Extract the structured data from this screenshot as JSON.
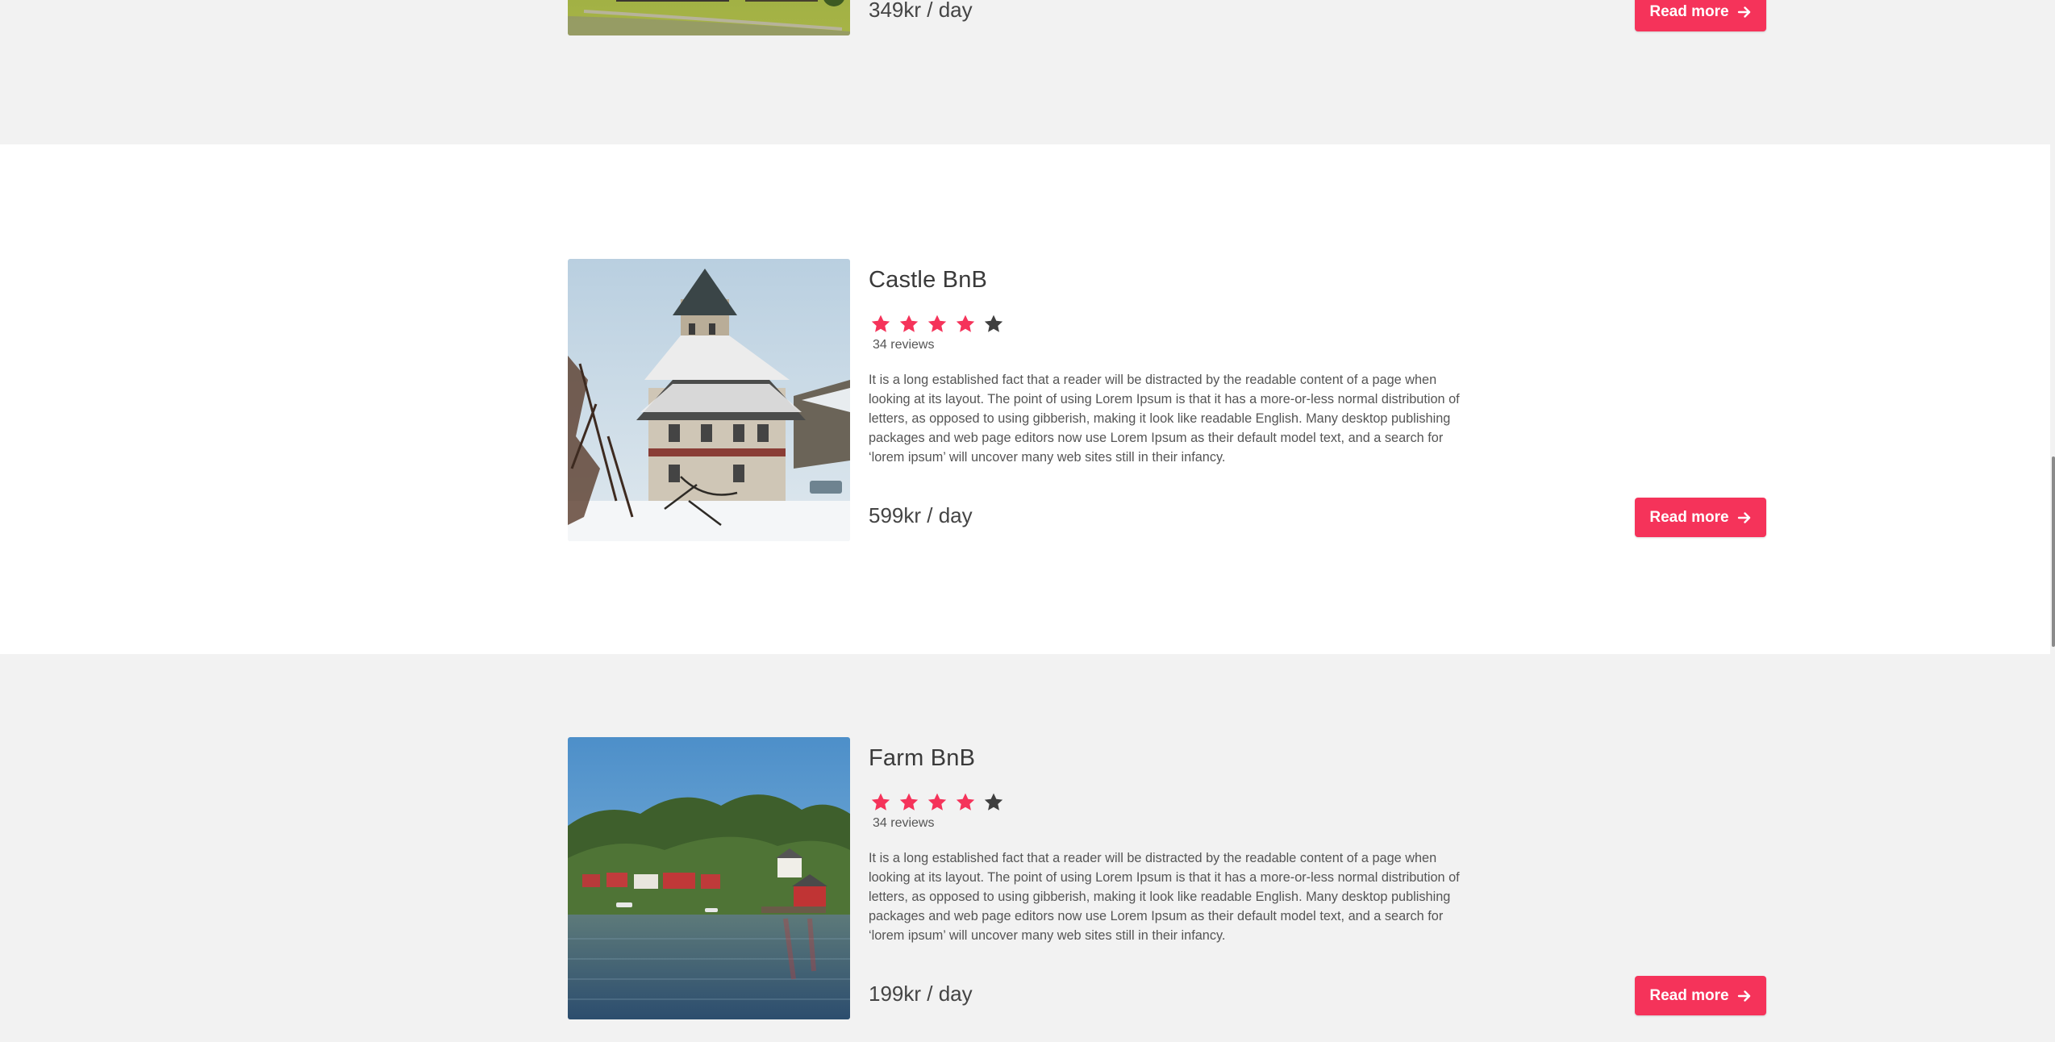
{
  "listings": [
    {
      "price": "349kr / day",
      "read_more": "Read more",
      "image": "green-lawn-photo"
    },
    {
      "title": "Castle BnB",
      "rating": 4,
      "rating_max": 5,
      "reviews": "34 reviews",
      "description": "It is a long established fact that a reader will be distracted by the readable content of a page when looking at its layout. The point of using Lorem Ipsum is that it has a more-or-less normal distribution of letters, as opposed to using gibberish, making it look like readable English. Many desktop publishing packages and web page editors now use Lorem Ipsum as their default model text, and a search for ‘lorem ipsum’ will uncover many web sites still in their infancy.",
      "price": "599kr / day",
      "read_more": "Read more",
      "image": "snowy-castle-photo"
    },
    {
      "title": "Farm BnB",
      "rating": 4,
      "rating_max": 5,
      "reviews": "34 reviews",
      "description": "It is a long established fact that a reader will be distracted by the readable content of a page when looking at its layout. The point of using Lorem Ipsum is that it has a more-or-less normal distribution of letters, as opposed to using gibberish, making it look like readable English. Many desktop publishing packages and web page editors now use Lorem Ipsum as their default model text, and a search for ‘lorem ipsum’ will uncover many web sites still in their infancy.",
      "price": "199kr / day",
      "read_more": "Read more",
      "image": "fjord-farm-photo"
    }
  ],
  "colors": {
    "accent": "#f5335a",
    "star_filled": "#f5335a",
    "star_empty": "#3f3f3f",
    "band_gray": "#f2f2f2",
    "band_white": "#ffffff"
  }
}
